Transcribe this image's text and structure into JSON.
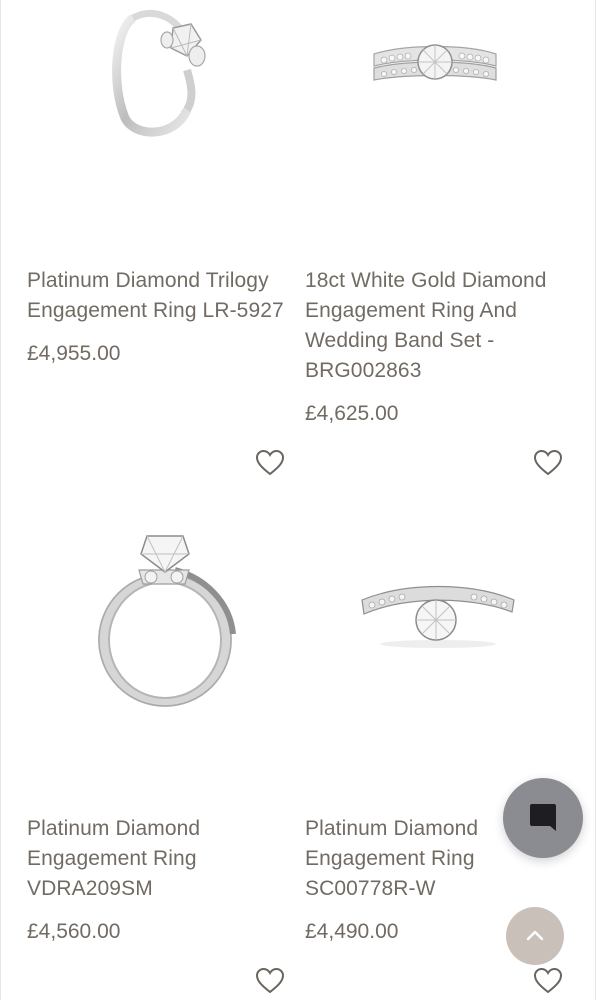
{
  "products": [
    {
      "title_lines": [
        "Platinum Diamond Trilogy",
        "Engagement Ring LR-5927"
      ],
      "price": "£4,955.00",
      "image_icon": "trilogy-ring-icon"
    },
    {
      "title_lines": [
        "18ct White Gold Diamond",
        "Engagement Ring And",
        "Wedding Band Set -",
        "BRG002863"
      ],
      "price": "£4,625.00",
      "image_icon": "ring-band-set-icon"
    },
    {
      "title_lines": [
        "Platinum Diamond",
        "Engagement Ring",
        "VDRA209SM"
      ],
      "price": "£4,560.00",
      "image_icon": "solitaire-ring-upright-icon"
    },
    {
      "title_lines": [
        "Platinum Diamond",
        "Engagement Ring",
        "SC00778R-W"
      ],
      "price": "£4,490.00",
      "image_icon": "solitaire-ring-pave-icon"
    }
  ],
  "icons": {
    "wishlist": "heart-icon",
    "chat": "chat-bubble-icon",
    "scroll_top": "chevron-up-icon"
  },
  "colors": {
    "text": "#716b63",
    "chat_button": "#8a8c92",
    "top_button": "#c9c0b9"
  }
}
